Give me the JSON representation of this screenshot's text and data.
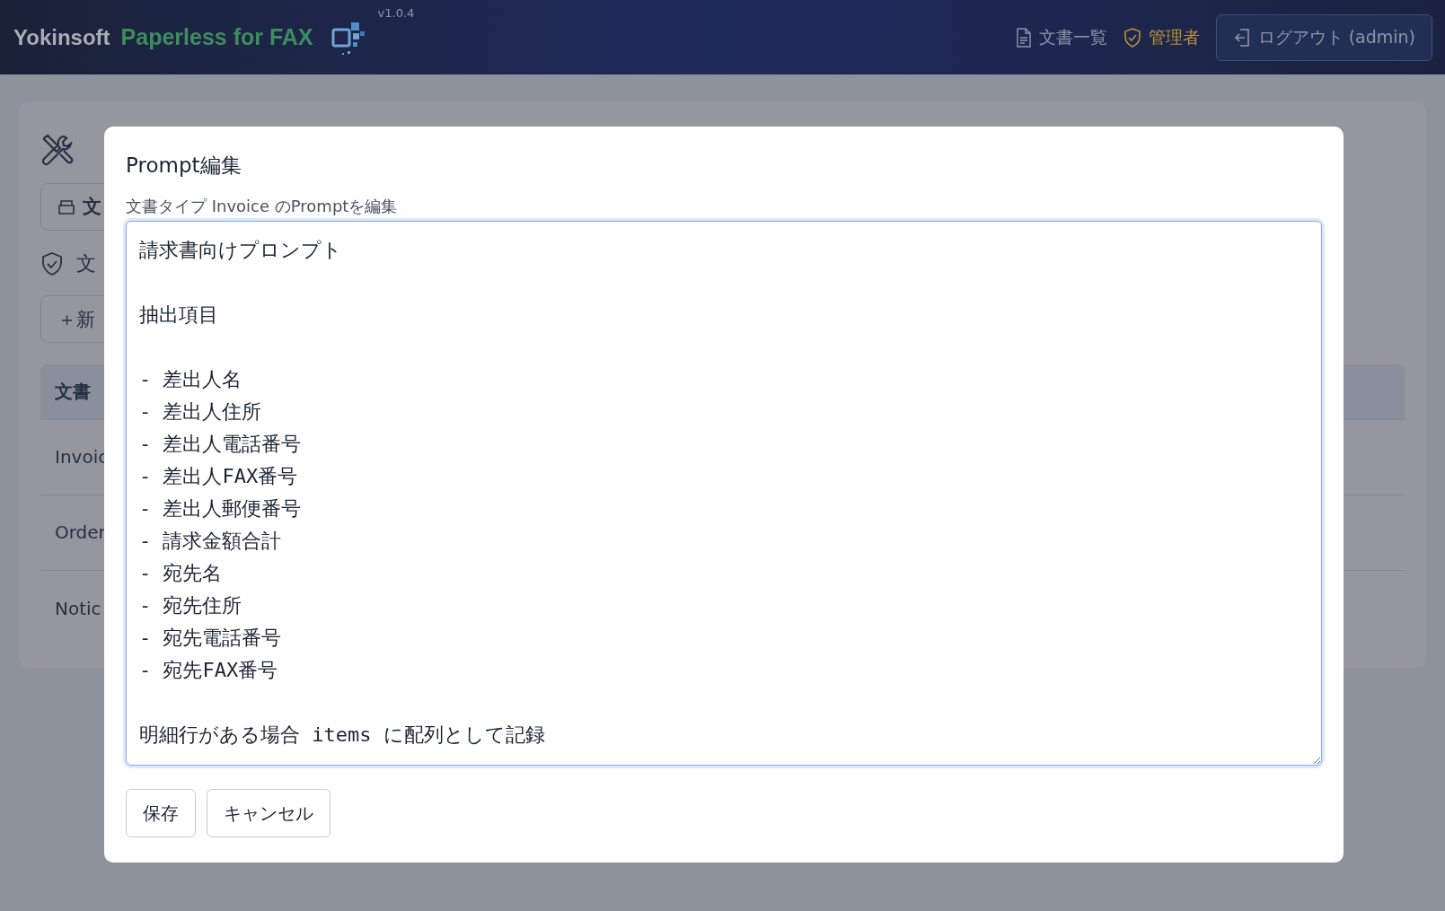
{
  "header": {
    "brand": "Yokinsoft",
    "product": "Paperless for FAX",
    "version": "v1.0.4",
    "nav": [
      {
        "label": "文書一覧",
        "kind": "document",
        "selected": false
      },
      {
        "label": "管理者",
        "kind": "admin",
        "selected": true
      }
    ],
    "logout_button": "ログアウト (admin)"
  },
  "background": {
    "tab_button": "文",
    "section_label": "文",
    "new_button": "＋新",
    "table_header": "文書",
    "rows": [
      "Invoic",
      "Order",
      "Notic"
    ]
  },
  "modal": {
    "title": "Prompt編集",
    "label": "文書タイプ Invoice のPromptを編集",
    "prompt_paragraphs": [
      [
        "請求書向けプロンプト"
      ],
      [
        "抽出項目"
      ],
      [
        "- 差出人名",
        "- 差出人住所",
        "- 差出人電話番号",
        "- 差出人FAX番号",
        "- 差出人郵便番号",
        "- 請求金額合計",
        "- 宛先名",
        "- 宛先住所",
        "- 宛先電話番号",
        "- 宛先FAX番号"
      ],
      [
        "明細行がある場合 items に配列として記録"
      ]
    ],
    "buttons": [
      "保存",
      "キャンセル"
    ]
  }
}
